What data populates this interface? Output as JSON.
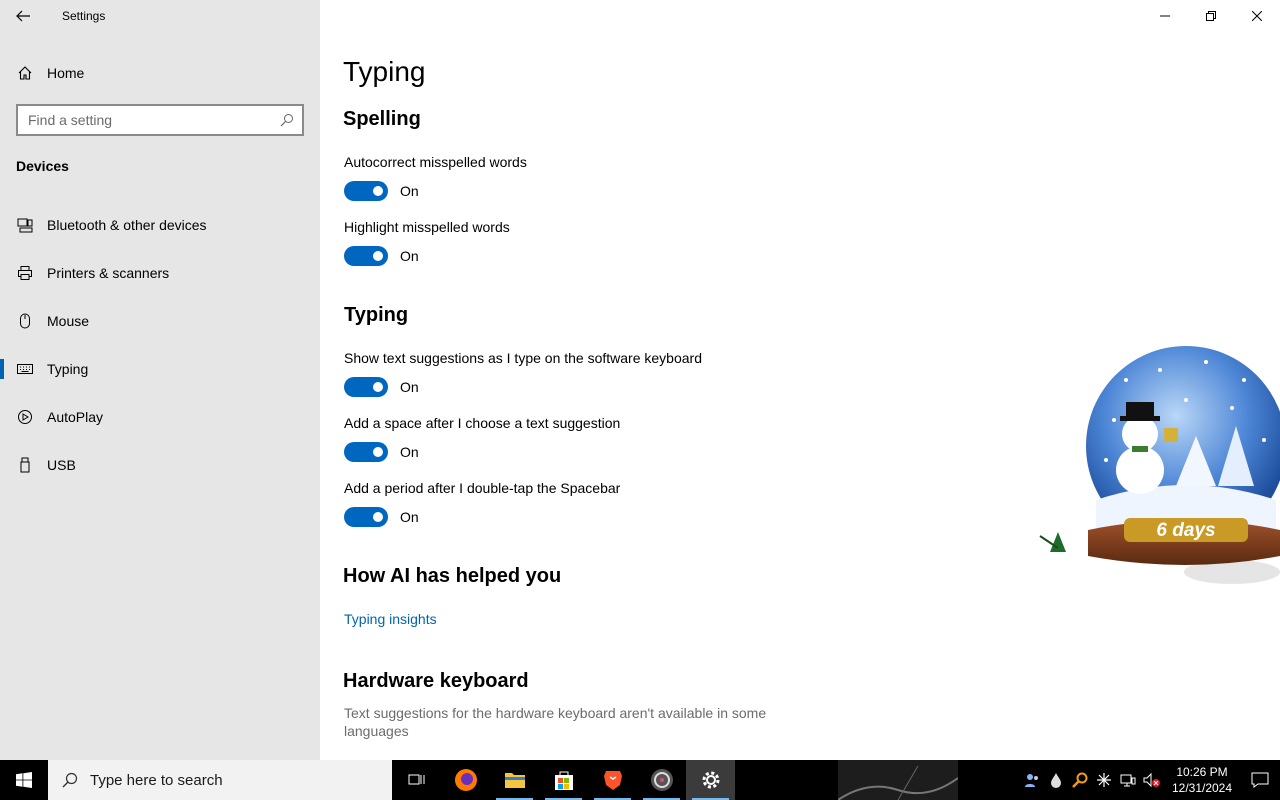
{
  "window": {
    "app_title": "Settings"
  },
  "sidebar": {
    "home_label": "Home",
    "search_placeholder": "Find a setting",
    "section": "Devices",
    "items": [
      {
        "label": "Bluetooth & other devices",
        "icon": "bluetooth-devices-icon",
        "selected": false
      },
      {
        "label": "Printers & scanners",
        "icon": "printer-icon",
        "selected": false
      },
      {
        "label": "Mouse",
        "icon": "mouse-icon",
        "selected": false
      },
      {
        "label": "Typing",
        "icon": "keyboard-icon",
        "selected": true
      },
      {
        "label": "AutoPlay",
        "icon": "autoplay-icon",
        "selected": false
      },
      {
        "label": "USB",
        "icon": "usb-icon",
        "selected": false
      }
    ]
  },
  "main": {
    "title": "Typing",
    "spelling": {
      "heading": "Spelling",
      "settings": [
        {
          "label": "Autocorrect misspelled words",
          "state": "On"
        },
        {
          "label": "Highlight misspelled words",
          "state": "On"
        }
      ]
    },
    "typing": {
      "heading": "Typing",
      "settings": [
        {
          "label": "Show text suggestions as I type on the software keyboard",
          "state": "On"
        },
        {
          "label": "Add a space after I choose a text suggestion",
          "state": "On"
        },
        {
          "label": "Add a period after I double-tap the Spacebar",
          "state": "On"
        }
      ]
    },
    "ai": {
      "heading": "How AI has helped you",
      "link": "Typing insights"
    },
    "hardware": {
      "heading": "Hardware keyboard",
      "description": "Text suggestions for the hardware keyboard aren't available in some languages"
    }
  },
  "widget": {
    "countdown": "6 days"
  },
  "taskbar": {
    "search_placeholder": "Type here to search",
    "apps": [
      "task-view",
      "firefox",
      "file-explorer",
      "microsoft-store",
      "brave",
      "media-app",
      "settings"
    ],
    "time": "10:26 PM",
    "date": "12/31/2024"
  },
  "colors": {
    "accent": "#0067c0",
    "sidebar_bg": "#e6e6e6",
    "link": "#0063b1"
  }
}
